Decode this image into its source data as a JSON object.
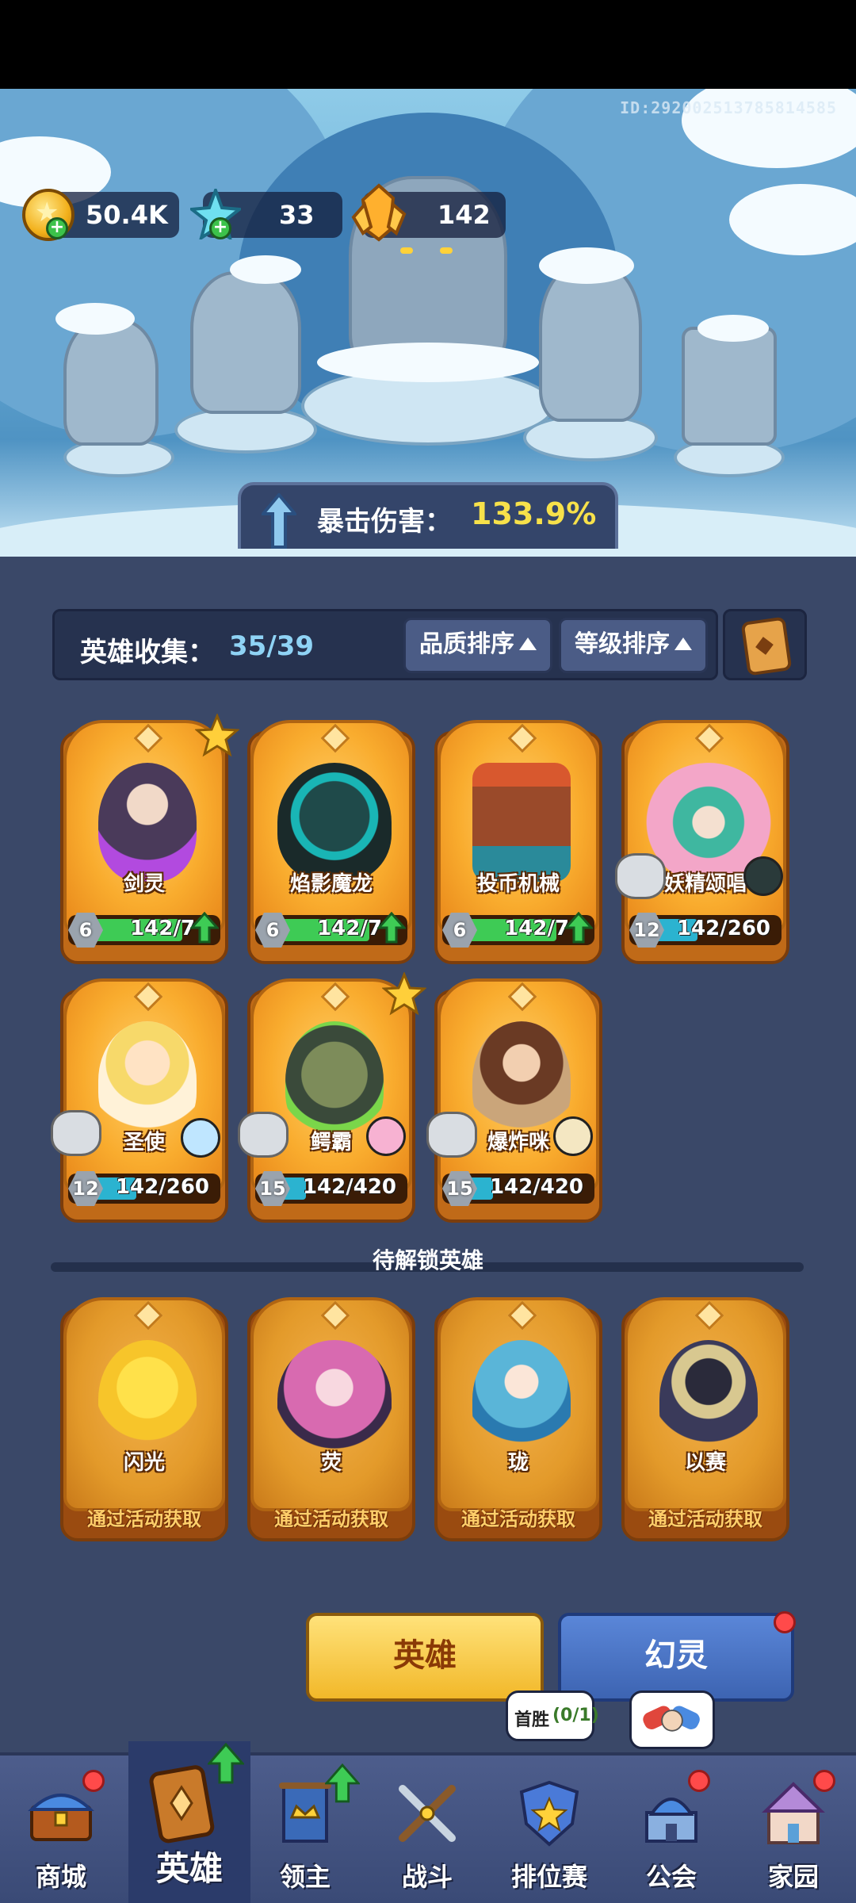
{
  "player_id": "ID:292002513785814585",
  "resources": {
    "gold": "50.4K",
    "crystal": "33",
    "amber": "142"
  },
  "crit": {
    "label": "暴击伤害：",
    "value": "133.9%"
  },
  "collection": {
    "label": "英雄收集：",
    "count": "35/39",
    "sort_quality": "品质排序",
    "sort_level": "等级排序"
  },
  "heroes": [
    {
      "name": "剑灵",
      "level": "6",
      "progress": "142/7",
      "star": true,
      "upgrade": true
    },
    {
      "name": "焰影魔龙",
      "level": "6",
      "progress": "142/7",
      "star": false,
      "upgrade": true
    },
    {
      "name": "投币机械",
      "level": "6",
      "progress": "142/7",
      "star": false,
      "upgrade": true
    },
    {
      "name": "妖精颂唱",
      "level": "12",
      "progress": "142/260",
      "star": false,
      "upgrade": false
    },
    {
      "name": "圣使",
      "level": "12",
      "progress": "142/260",
      "star": false,
      "upgrade": false
    },
    {
      "name": "鳄霸",
      "level": "15",
      "progress": "142/420",
      "star": true,
      "upgrade": false
    },
    {
      "name": "爆炸咪",
      "level": "15",
      "progress": "142/420",
      "star": false,
      "upgrade": false
    }
  ],
  "locked_section_title": "待解锁英雄",
  "locked_heroes": [
    {
      "name": "闪光",
      "hint": "通过活动获取"
    },
    {
      "name": "荧",
      "hint": "通过活动获取"
    },
    {
      "name": "珑",
      "hint": "通过活动获取"
    },
    {
      "name": "以赛",
      "hint": "通过活动获取"
    }
  ],
  "tabs": {
    "hero": "英雄",
    "phantom": "幻灵"
  },
  "first_win_bubble": {
    "label": "首胜",
    "count": "(0/1)"
  },
  "nav": [
    {
      "label": "商城"
    },
    {
      "label": "英雄"
    },
    {
      "label": "领主"
    },
    {
      "label": "战斗"
    },
    {
      "label": "排位赛"
    },
    {
      "label": "公会"
    },
    {
      "label": "家园"
    }
  ],
  "colors": {
    "accent_yellow": "#f7e14a",
    "card_orange": "#f9ac2e",
    "level_cyan": "#2bb3d0",
    "level_green": "#3ecb55",
    "notification_red": "#ff4a4a"
  }
}
